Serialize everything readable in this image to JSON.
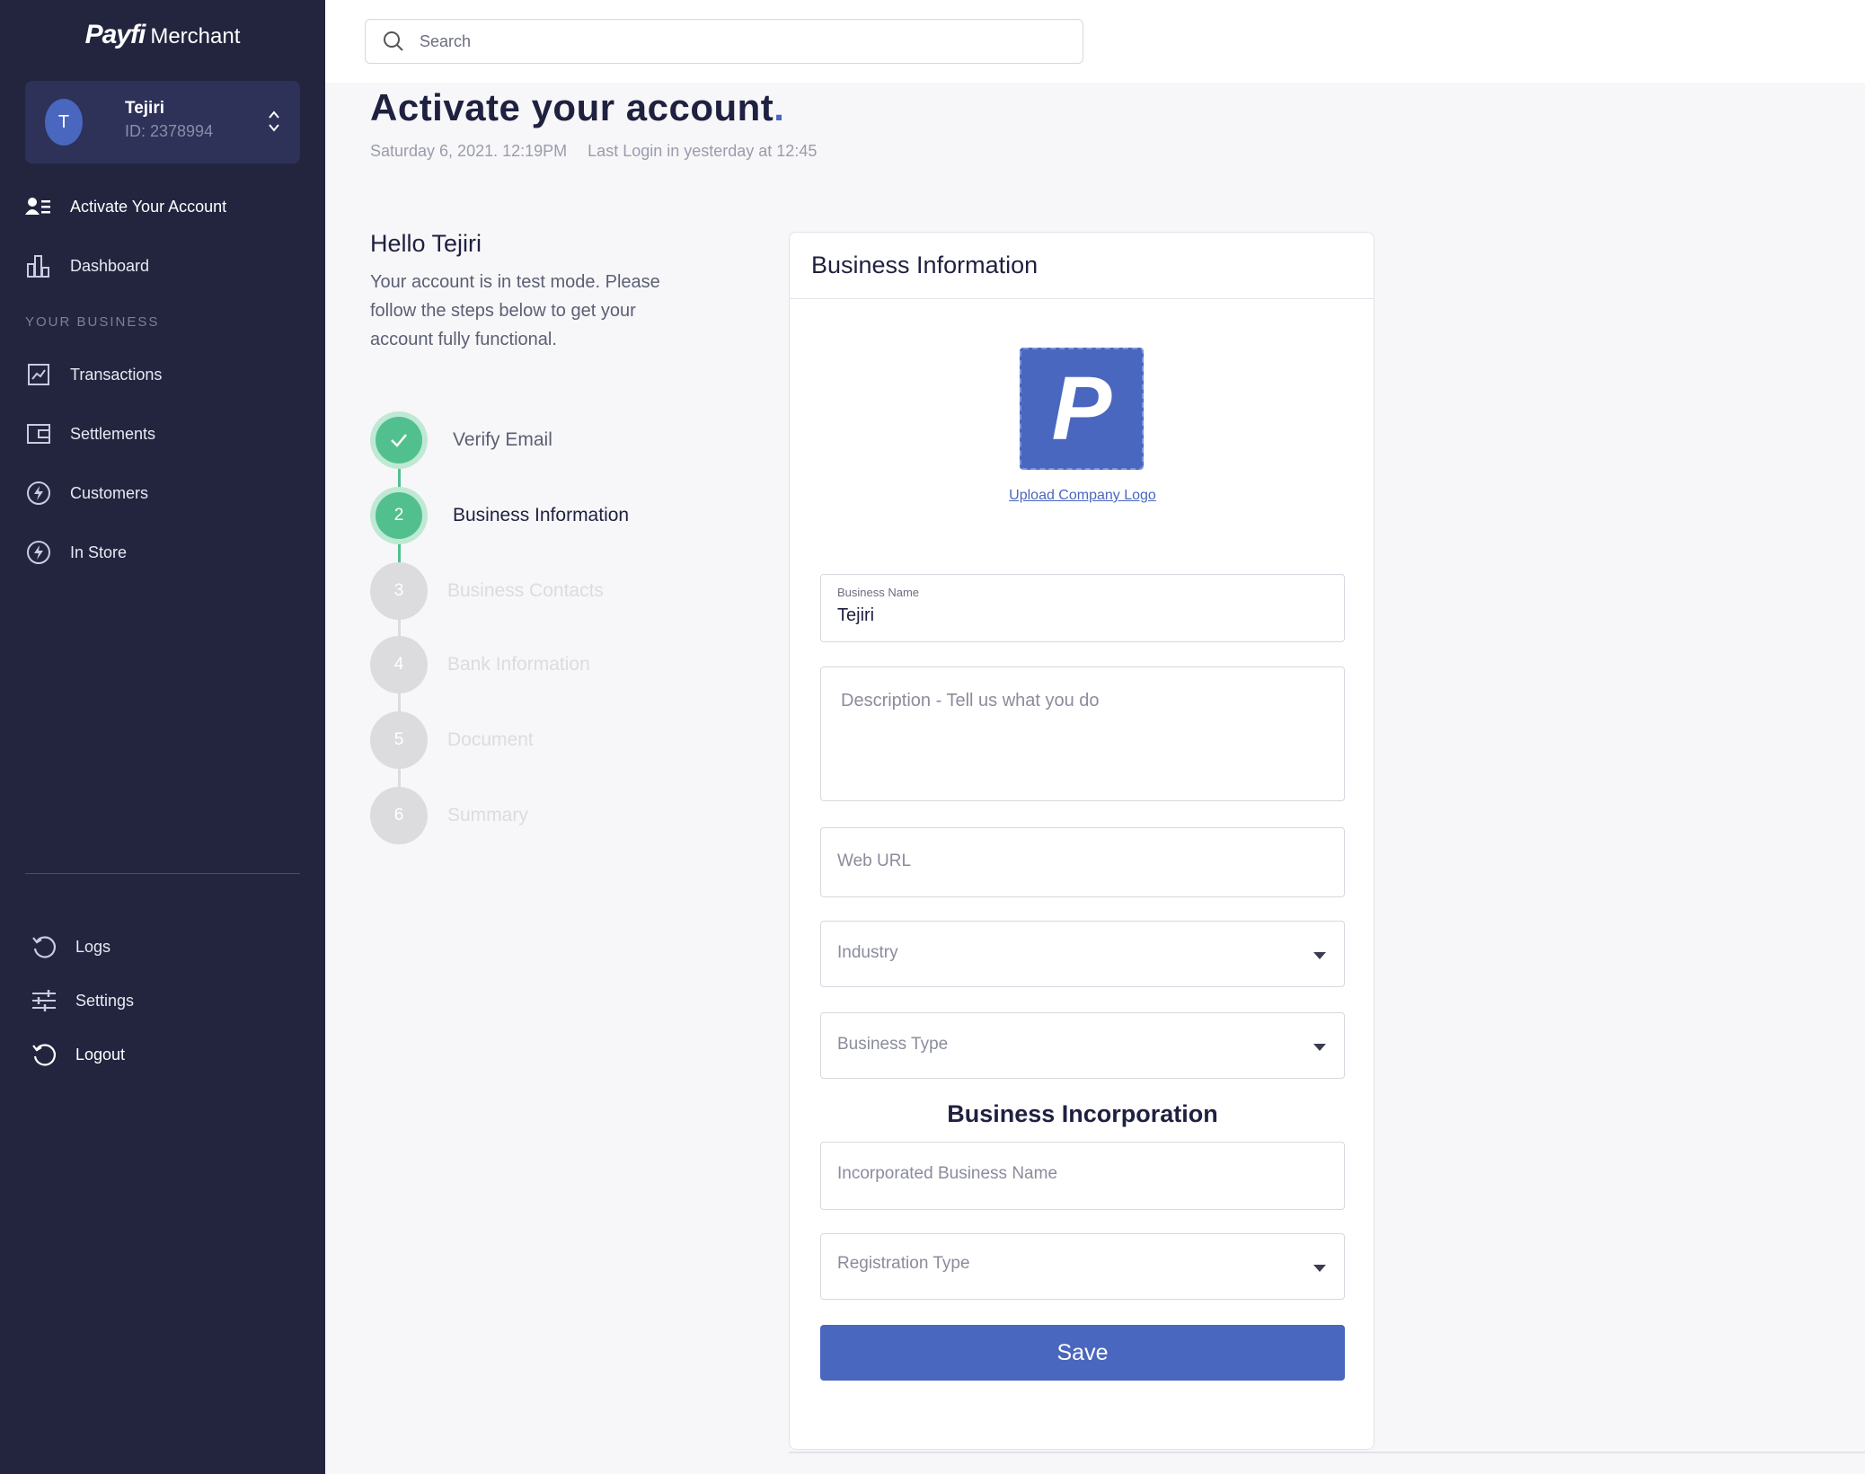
{
  "brand": {
    "logo": "Payfi",
    "suffix": "Merchant"
  },
  "user": {
    "initial": "T",
    "name": "Tejiri",
    "id": "ID: 2378994"
  },
  "sidebar": {
    "primary": [
      {
        "label": "Activate Your Account",
        "icon": "user-list-icon"
      },
      {
        "label": "Dashboard",
        "icon": "bar-chart-icon"
      }
    ],
    "section_label": "YOUR BUSINESS",
    "business": [
      {
        "label": "Transactions",
        "icon": "trend-chart-icon"
      },
      {
        "label": "Settlements",
        "icon": "wallet-icon"
      },
      {
        "label": "Customers",
        "icon": "lightning-icon"
      },
      {
        "label": "In Store",
        "icon": "lightning-icon"
      }
    ],
    "bottom": [
      {
        "label": "Logs",
        "icon": "refresh-icon"
      },
      {
        "label": "Settings",
        "icon": "sliders-icon"
      },
      {
        "label": "Logout",
        "icon": "refresh-icon"
      }
    ]
  },
  "search": {
    "placeholder": "Search"
  },
  "page": {
    "title": "Activate your account",
    "title_dot": ".",
    "date": "Saturday 6, 2021. 12:19PM",
    "last_login": "Last Login in yesterday at 12:45",
    "hello": "Hello Tejiri",
    "intro": "Your account is in test mode. Please follow the steps below to get your account fully functional."
  },
  "steps": [
    {
      "number": "",
      "label": "Verify Email",
      "state": "done"
    },
    {
      "number": "2",
      "label": "Business Information",
      "state": "current"
    },
    {
      "number": "3",
      "label": "Business Contacts",
      "state": "pending"
    },
    {
      "number": "4",
      "label": "Bank Information",
      "state": "pending"
    },
    {
      "number": "5",
      "label": "Document",
      "state": "pending"
    },
    {
      "number": "6",
      "label": "Summary",
      "state": "pending"
    }
  ],
  "card": {
    "title": "Business Information",
    "logo_letter": "P",
    "upload_label": "Upload Company Logo",
    "business_name_label": "Business Name",
    "business_name_value": "Tejiri",
    "description_placeholder": "Description - Tell us what you do",
    "web_url_placeholder": "Web URL",
    "industry_placeholder": "Industry",
    "business_type_placeholder": "Business Type",
    "incorporation_title": "Business Incorporation",
    "incorporated_name_placeholder": "Incorporated Business Name",
    "registration_type_placeholder": "Registration Type",
    "save_label": "Save"
  },
  "colors": {
    "sidebar": "#23253f",
    "accent": "#4a67bf",
    "success": "#52c08e"
  }
}
